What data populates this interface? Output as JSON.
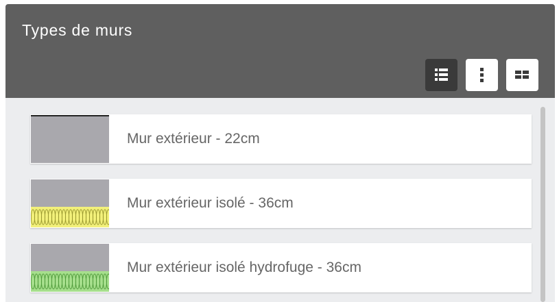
{
  "panel": {
    "title": "Types de murs"
  },
  "view_buttons": [
    {
      "icon": "list-view-icon",
      "active": true
    },
    {
      "icon": "vertical-dots-icon",
      "active": false
    },
    {
      "icon": "grid-view-icon",
      "active": false
    }
  ],
  "walls": [
    {
      "label": "Mur extérieur - 22cm",
      "insulation": "none"
    },
    {
      "label": "Mur extérieur isolé - 36cm",
      "insulation": "yellow"
    },
    {
      "label": "Mur extérieur isolé hydrofuge - 36cm",
      "insulation": "green"
    }
  ],
  "colors": {
    "header": "#5f5f5f",
    "body": "#ecedef",
    "wall_gray": "#a9a8ad",
    "insulation_yellow": "#f2f07a",
    "insulation_green": "#a6df8c",
    "active_button": "#3a3a3a"
  }
}
